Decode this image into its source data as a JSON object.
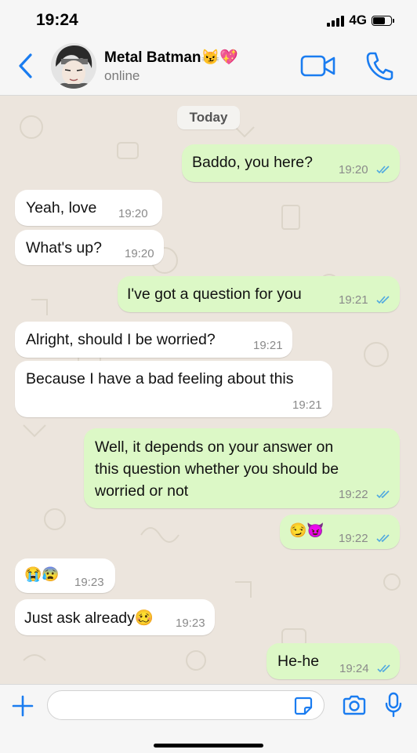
{
  "status_bar": {
    "time": "19:24",
    "network": "4G"
  },
  "header": {
    "contact_name": "Metal Batman😼💖",
    "contact_status": "online"
  },
  "chat": {
    "day_label": "Today",
    "messages": [
      {
        "dir": "out",
        "text": "Baddo, you here?",
        "time": "19:20",
        "read": true
      },
      {
        "dir": "in",
        "text": "Yeah, love",
        "time": "19:20"
      },
      {
        "dir": "in",
        "text": "What's up?",
        "time": "19:20"
      },
      {
        "dir": "out",
        "text": "I've got a question for you",
        "time": "19:21",
        "read": true
      },
      {
        "dir": "in",
        "text": "Alright, should I be worried?",
        "time": "19:21"
      },
      {
        "dir": "in",
        "text": "Because I have a bad feeling about this",
        "time": "19:21"
      },
      {
        "dir": "out",
        "lines": [
          "Well, it depends on your answer on",
          "this question whether you should be",
          "worried or not"
        ],
        "time": "19:22",
        "read": true
      },
      {
        "dir": "out",
        "text": "😏😈",
        "time": "19:22",
        "read": true
      },
      {
        "dir": "in",
        "text": "😭😰",
        "time": "19:23"
      },
      {
        "dir": "in",
        "text": "Just ask already🥴",
        "time": "19:23"
      },
      {
        "dir": "out",
        "text": "He-he",
        "time": "19:24",
        "read": true
      }
    ]
  },
  "composer": {
    "placeholder": ""
  },
  "colors": {
    "accent": "#1a7cf0",
    "outgoing_bubble": "#dcf8c6",
    "incoming_bubble": "#ffffff",
    "read_ticks": "#4fa8e0"
  }
}
